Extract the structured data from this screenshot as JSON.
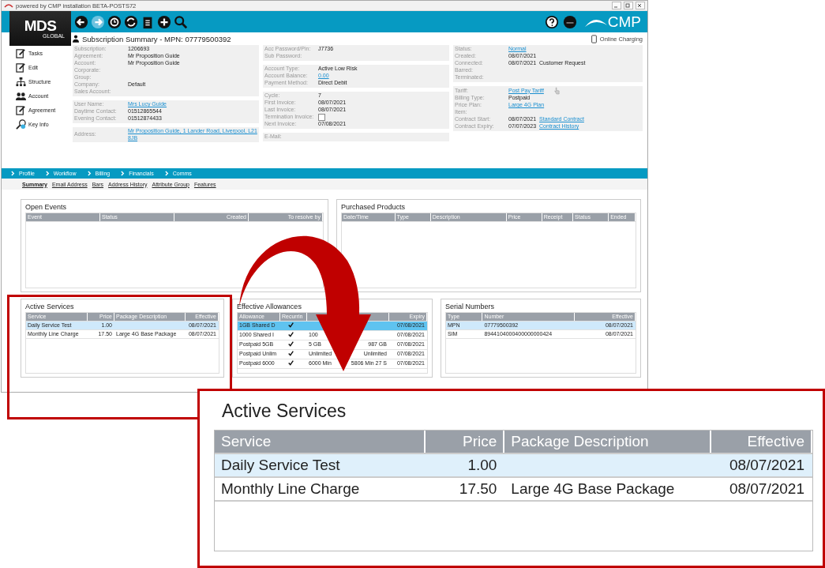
{
  "window": {
    "title": "powered by CMP installation BETA-POSTS72"
  },
  "header": {
    "logo": "MDS",
    "logo_sub": "GLOBAL",
    "brand": "CMP"
  },
  "summary": {
    "title": "Subscription Summary - MPN: 07779500392",
    "online": "Online Charging"
  },
  "sidebar": {
    "items": [
      {
        "label": "Tasks"
      },
      {
        "label": "Edit"
      },
      {
        "label": "Structure"
      },
      {
        "label": "Account"
      },
      {
        "label": "Agreement"
      },
      {
        "label": "Key Info"
      }
    ]
  },
  "details": [
    [
      {
        "fields": [
          {
            "label": "Subscription:",
            "values": [
              {
                "kind": "text",
                "text": "1206693"
              }
            ]
          },
          {
            "label": "Agreement:",
            "values": [
              {
                "kind": "text",
                "text": "Mr Proposition Guide"
              }
            ]
          },
          {
            "label": "Account:",
            "values": [
              {
                "kind": "text",
                "text": "Mr Proposition Guide"
              }
            ]
          },
          {
            "label": "Corporate:"
          },
          {
            "label": "Group:"
          },
          {
            "label": "Company:",
            "values": [
              {
                "kind": "text",
                "text": "Default"
              }
            ]
          },
          {
            "label": "Sales Account:"
          }
        ]
      },
      {
        "fields": [
          {
            "label": "User Name:",
            "values": [
              {
                "kind": "link",
                "text": "Mrs Lucy Guide"
              }
            ]
          },
          {
            "label": "Daytime Contact:",
            "values": [
              {
                "kind": "text",
                "text": "01512865544"
              }
            ]
          },
          {
            "label": "Evening Contact:",
            "values": [
              {
                "kind": "text",
                "text": "01512874433"
              }
            ]
          }
        ]
      },
      {
        "fields": [
          {
            "label": "Address:",
            "values": [
              {
                "kind": "link",
                "text": "Mr Proposition Guide, 1 Lander Road, Liverpool, L21 8JB"
              }
            ]
          }
        ]
      }
    ],
    [
      {
        "fields": [
          {
            "label": "Acc Password/Pin:",
            "values": [
              {
                "kind": "text",
                "text": "J7736"
              }
            ]
          },
          {
            "label": "Sub Password:"
          }
        ]
      },
      {
        "fields": [
          {
            "label": "Account Type:",
            "values": [
              {
                "kind": "text",
                "text": "Active Low Risk"
              }
            ]
          },
          {
            "label": "Account Balance:",
            "values": [
              {
                "kind": "link",
                "text": "0.00"
              }
            ]
          },
          {
            "label": "Payment Method:",
            "values": [
              {
                "kind": "text",
                "text": "Direct Debit"
              }
            ]
          }
        ]
      },
      {
        "fields": [
          {
            "label": "Cycle:",
            "values": [
              {
                "kind": "text",
                "text": "7"
              }
            ]
          },
          {
            "label": "First Invoice:",
            "values": [
              {
                "kind": "text",
                "text": "08/07/2021"
              }
            ]
          },
          {
            "label": "Last Invoice:",
            "values": [
              {
                "kind": "text",
                "text": "08/07/2021"
              }
            ]
          },
          {
            "label": "Termination Invoice:",
            "checked": false
          },
          {
            "label": "Next Invoice:",
            "values": [
              {
                "kind": "text",
                "text": "07/08/2021"
              }
            ]
          }
        ]
      },
      {
        "fields": [
          {
            "label": "E-Mail:"
          }
        ]
      }
    ],
    [
      {
        "fields": [
          {
            "label": "Status:",
            "values": [
              {
                "kind": "link",
                "text": "Normal"
              }
            ]
          },
          {
            "label": "Created:",
            "values": [
              {
                "kind": "text",
                "text": "08/07/2021"
              }
            ]
          },
          {
            "label": "Connected:",
            "values": [
              {
                "kind": "text",
                "text": "08/07/2021"
              },
              {
                "kind": "text",
                "text": "Customer Request"
              }
            ]
          },
          {
            "label": "Barred:"
          },
          {
            "label": "Terminated:"
          }
        ]
      },
      {
        "fields": [
          {
            "label": "Tariff:",
            "values": [
              {
                "kind": "link",
                "text": "Post Pay Tariff"
              }
            ],
            "pointer": true
          },
          {
            "label": "Billing Type:",
            "values": [
              {
                "kind": "text",
                "text": "Postpaid"
              }
            ]
          },
          {
            "label": "Price Plan:",
            "values": [
              {
                "kind": "link",
                "text": "Large 4G Plan"
              }
            ]
          },
          {
            "label": "Item:"
          },
          {
            "label": "Contract Start:",
            "values": [
              {
                "kind": "text",
                "text": "08/07/2021"
              },
              {
                "kind": "link",
                "text": "Standard Contract"
              }
            ]
          },
          {
            "label": "Contract Expiry:",
            "values": [
              {
                "kind": "text",
                "text": "07/07/2023"
              },
              {
                "kind": "link",
                "text": "Contract History"
              }
            ]
          }
        ]
      }
    ]
  ],
  "nav_tabs": [
    {
      "label": "Profile",
      "selected": false
    },
    {
      "label": "Workflow",
      "selected": false
    },
    {
      "label": "Billing",
      "selected": false
    },
    {
      "label": "Financials",
      "selected": false
    },
    {
      "label": "Comms",
      "selected": false
    }
  ],
  "sub_tabs": [
    {
      "label": "Summary",
      "selected": true
    },
    {
      "label": "Email Address",
      "selected": false
    },
    {
      "label": "Bars",
      "selected": false
    },
    {
      "label": "Address History",
      "selected": false
    },
    {
      "label": "Attribute Group",
      "selected": false
    },
    {
      "label": "Features",
      "selected": false
    }
  ],
  "open_events": {
    "title": "Open Events",
    "columns": [
      "Event",
      "Status",
      "Created",
      "To resolve by"
    ]
  },
  "purchased_products": {
    "title": "Purchased Products",
    "columns": [
      "Date/Time",
      "Type",
      "Description",
      "Price",
      "Receipt",
      "Status",
      "Ended"
    ]
  },
  "active_services": {
    "title": "Active Services",
    "columns": [
      "Service",
      "Price",
      "Package Description",
      "Effective"
    ],
    "rows": [
      {
        "selected": true,
        "cells": [
          "Daily Service Test",
          "1.00",
          "",
          "08/07/2021"
        ]
      },
      {
        "selected": false,
        "cells": [
          "Monthly Line Charge",
          "17.50",
          "Large 4G Base Package",
          "08/07/2021"
        ]
      }
    ]
  },
  "effective_allowances": {
    "title": "Effective Allowances",
    "columns": [
      "Allowance",
      "Recurrin",
      "",
      "",
      "Expiry"
    ],
    "rows": [
      {
        "selected": true,
        "recurring": true,
        "cells": [
          "1GB Shared D",
          "",
          "",
          "",
          "07/08/2021"
        ]
      },
      {
        "selected": false,
        "recurring": true,
        "cells": [
          "1000 Shared I",
          "",
          "100",
          "",
          "07/08/2021"
        ]
      },
      {
        "selected": false,
        "recurring": true,
        "cells": [
          "Postpaid 5GB",
          "",
          "5 GB",
          "987 GB",
          "07/08/2021"
        ]
      },
      {
        "selected": false,
        "recurring": true,
        "cells": [
          "Postpaid Unlim",
          "",
          "Unlimited",
          "Unlimited",
          "07/08/2021"
        ]
      },
      {
        "selected": false,
        "recurring": true,
        "cells": [
          "Postpaid 6000",
          "",
          "6000 Min",
          "5806 Min 27 S",
          "07/08/2021"
        ]
      }
    ]
  },
  "serial_numbers": {
    "title": "Serial Numbers",
    "columns": [
      "Type",
      "Number",
      "Effective"
    ],
    "rows": [
      {
        "selected": true,
        "cells": [
          "MPN",
          "07779500392",
          "08/07/2021"
        ]
      },
      {
        "selected": false,
        "cells": [
          "SIM",
          "8944104000400000000424",
          "08/07/2021"
        ]
      }
    ]
  },
  "callout": {
    "title": "Active Services",
    "columns": [
      "Service",
      "Price",
      "Package Description",
      "Effective"
    ],
    "rows": [
      {
        "selected": true,
        "cells": [
          "Daily Service Test",
          "1.00",
          "",
          "08/07/2021"
        ]
      },
      {
        "selected": false,
        "cells": [
          "Monthly Line Charge",
          "17.50",
          "Large 4G Base Package",
          "08/07/2021"
        ]
      }
    ]
  }
}
